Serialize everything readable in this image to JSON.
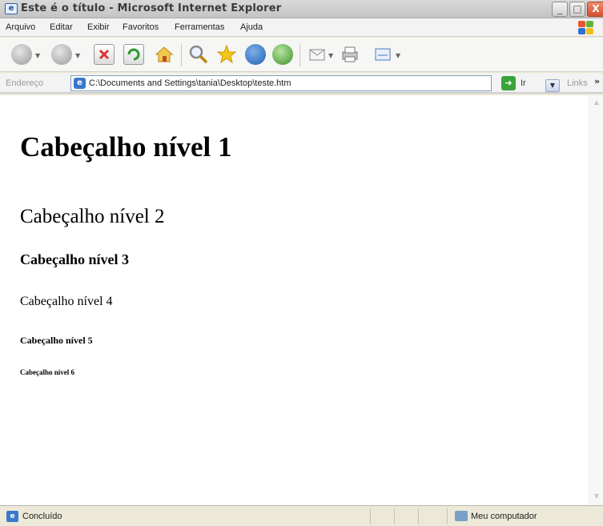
{
  "window": {
    "title": "Este é o título - Microsoft Internet Explorer",
    "minimize": "_",
    "maximize": "□",
    "close": "X"
  },
  "menu": {
    "items": [
      "Arquivo",
      "Editar",
      "Exibir",
      "Favoritos",
      "Ferramentas",
      "Ajuda"
    ]
  },
  "toolbar": {
    "icons": [
      "back-icon",
      "forward-icon",
      "stop-icon",
      "refresh-icon",
      "home-icon",
      "search-icon",
      "favorites-icon",
      "media-icon",
      "history-icon",
      "mail-icon",
      "print-icon",
      "edit-icon"
    ]
  },
  "address": {
    "label": "Endereço",
    "value": "C:\\Documents and Settings\\tania\\Desktop\\teste.htm",
    "go_label": "Ir",
    "links_label": "Links"
  },
  "content": {
    "h1": "Cabeçalho nível 1",
    "h2": "Cabeçalho nível 2",
    "h3": "Cabeçalho nível 3",
    "h4": "Cabeçalho nível 4",
    "h5": "Cabeçalho nível 5",
    "h6": "Cabeçalho nível 6"
  },
  "status": {
    "text": "Concluído",
    "zone": "Meu computador"
  },
  "colors": {
    "accent": "#3a78c9",
    "go": "#3aa33a",
    "close": "#d4502e"
  }
}
